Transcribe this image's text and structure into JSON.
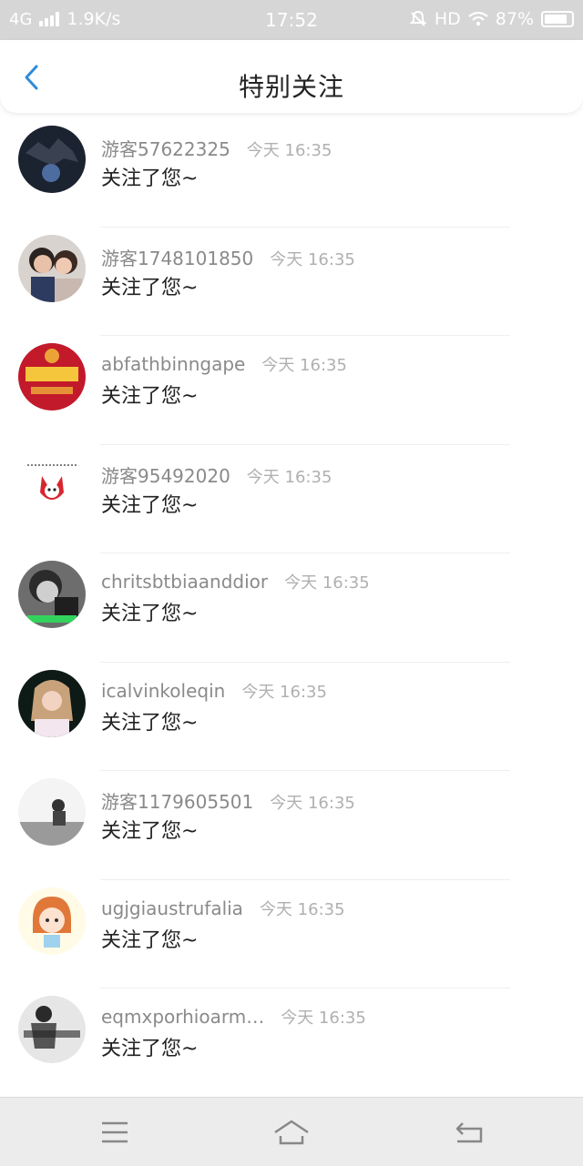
{
  "status_bar": {
    "network": "4G",
    "speed": "1.9K/s",
    "time": "17:52",
    "hd": "HD",
    "battery": "87%"
  },
  "header": {
    "title": "特别关注"
  },
  "colors": {
    "accent": "#2f8bd8",
    "status_bg": "#d6d6d6",
    "name_gray": "#8a8a8a"
  },
  "items": [
    {
      "name": "游客57622325",
      "time": "今天 16:35",
      "message": "关注了您~"
    },
    {
      "name": "游客1748101850",
      "time": "今天 16:35",
      "message": "关注了您~"
    },
    {
      "name": "abfathbinngape",
      "time": "今天 16:35",
      "message": "关注了您~"
    },
    {
      "name": "游客95492020",
      "time": "今天 16:35",
      "message": "关注了您~"
    },
    {
      "name": "chritsbtbiaanddior",
      "time": "今天 16:35",
      "message": "关注了您~"
    },
    {
      "name": "icalvinkoleqin",
      "time": "今天 16:35",
      "message": "关注了您~"
    },
    {
      "name": "游客1179605501",
      "time": "今天 16:35",
      "message": "关注了您~"
    },
    {
      "name": "ugjgiaustrufalia",
      "time": "今天 16:35",
      "message": "关注了您~"
    },
    {
      "name": "eqmxporhioarm…",
      "time": "今天 16:35",
      "message": "关注了您~"
    }
  ],
  "navbar": {
    "icons": [
      "menu-icon",
      "home-icon",
      "back-icon"
    ]
  }
}
